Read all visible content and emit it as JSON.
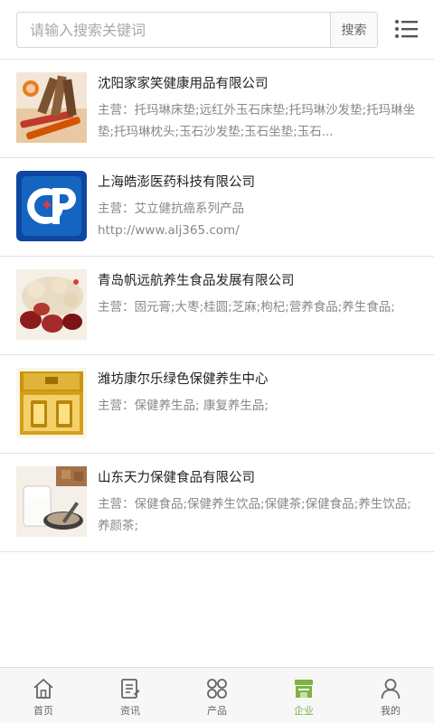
{
  "search": {
    "placeholder": "请输入搜索关键词",
    "button_label": "搜索"
  },
  "companies": [
    {
      "name": "沈阳家家笑健康用品有限公司",
      "main": "主营：托玛琳床垫;远红外玉石床垫;托玛琳沙发垫;托玛琳坐垫;托玛琳枕头;玉石沙发垫;玉石坐垫;玉石...",
      "url": ""
    },
    {
      "name": "上海皓澎医药科技有限公司",
      "main": "主营：艾立健抗癌系列产品",
      "url": "http://www.alj365.com/"
    },
    {
      "name": "青岛帆远航养生食品发展有限公司",
      "main": "主营：固元膏;大枣;桂圆;芝麻;枸杞;营养食品;养生食品;",
      "url": ""
    },
    {
      "name": "潍坊康尔乐绿色保健养生中心",
      "main": "主营：保健养生品; 康复养生品;",
      "url": ""
    },
    {
      "name": "山东天力保健食品有限公司",
      "main": "主营：保健食品;保健养生饮品;保健茶;保健食品;养生饮品;养颜茶;",
      "url": ""
    }
  ],
  "nav": {
    "home": "首页",
    "news": "资讯",
    "products": "产品",
    "company": "企业",
    "mine": "我的",
    "active_color": "#7cb342"
  }
}
